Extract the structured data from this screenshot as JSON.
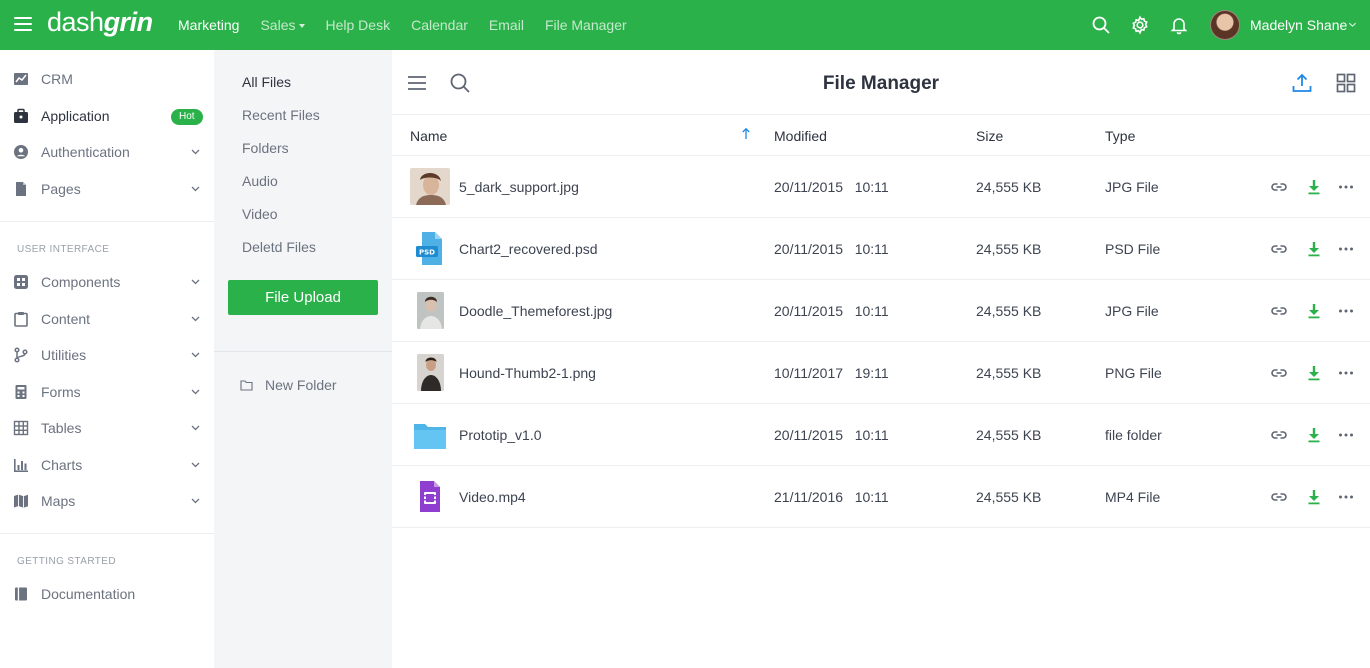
{
  "brand": {
    "name_light": "dash",
    "name_bold": "grin"
  },
  "topnav": [
    {
      "label": "Marketing",
      "active": true
    },
    {
      "label": "Sales",
      "has_caret": true
    },
    {
      "label": "Help Desk"
    },
    {
      "label": "Calendar"
    },
    {
      "label": "Email"
    },
    {
      "label": "File Manager"
    }
  ],
  "user": {
    "name": "Madelyn Shane"
  },
  "sidebar": {
    "items": [
      {
        "label": "CRM",
        "icon": "chart-line-icon"
      },
      {
        "label": "Application",
        "icon": "briefcase-icon",
        "active": true,
        "badge": "Hot"
      },
      {
        "label": "Authentication",
        "icon": "user-circle-icon",
        "expandable": true
      },
      {
        "label": "Pages",
        "icon": "page-icon",
        "expandable": true
      }
    ],
    "section_ui": "USER INTERFACE",
    "ui_items": [
      {
        "label": "Components",
        "icon": "components-icon"
      },
      {
        "label": "Content",
        "icon": "clipboard-icon"
      },
      {
        "label": "Utilities",
        "icon": "branch-icon"
      },
      {
        "label": "Forms",
        "icon": "calculator-icon"
      },
      {
        "label": "Tables",
        "icon": "grid-icon"
      },
      {
        "label": "Charts",
        "icon": "bar-chart-icon"
      },
      {
        "label": "Maps",
        "icon": "map-icon"
      }
    ],
    "section_started": "GETTING STARTED",
    "doc_label": "Documentation"
  },
  "files_nav": {
    "items": [
      "All Files",
      "Recent Files",
      "Folders",
      "Audio",
      "Video",
      "Deletd Files"
    ],
    "upload_label": "File Upload",
    "new_folder_label": "New Folder"
  },
  "main": {
    "title": "File Manager",
    "columns": {
      "name": "Name",
      "modified": "Modified",
      "size": "Size",
      "type": "Type"
    },
    "rows": [
      {
        "name": "5_dark_support.jpg",
        "date": "20/11/2015",
        "time": "10:11",
        "size": "24,555 KB",
        "type": "JPG File",
        "thumb": "photo"
      },
      {
        "name": "Chart2_recovered.psd",
        "date": "20/11/2015",
        "time": "10:11",
        "size": "24,555 KB",
        "type": "PSD File",
        "thumb": "psd",
        "thumb_label": "PSD"
      },
      {
        "name": "Doodle_Themeforest.jpg",
        "date": "20/11/2015",
        "time": "10:11",
        "size": "24,555 KB",
        "type": "JPG File",
        "thumb": "photo"
      },
      {
        "name": "Hound-Thumb2-1.png",
        "date": "10/11/2017",
        "time": "19:11",
        "size": "24,555 KB",
        "type": "PNG File",
        "thumb": "photo"
      },
      {
        "name": "Prototip_v1.0",
        "date": "20/11/2015",
        "time": "10:11",
        "size": "24,555 KB",
        "type": "file folder",
        "thumb": "folder"
      },
      {
        "name": "Video.mp4",
        "date": "21/11/2016",
        "time": "10:11",
        "size": "24,555 KB",
        "type": "MP4 File",
        "thumb": "video"
      }
    ]
  },
  "colors": {
    "brand_green": "#2bb14a",
    "link_blue": "#1e88e5",
    "folder_blue": "#64c4f2",
    "psd_blue": "#4fb0e6",
    "video_purple": "#8e3fcf"
  }
}
